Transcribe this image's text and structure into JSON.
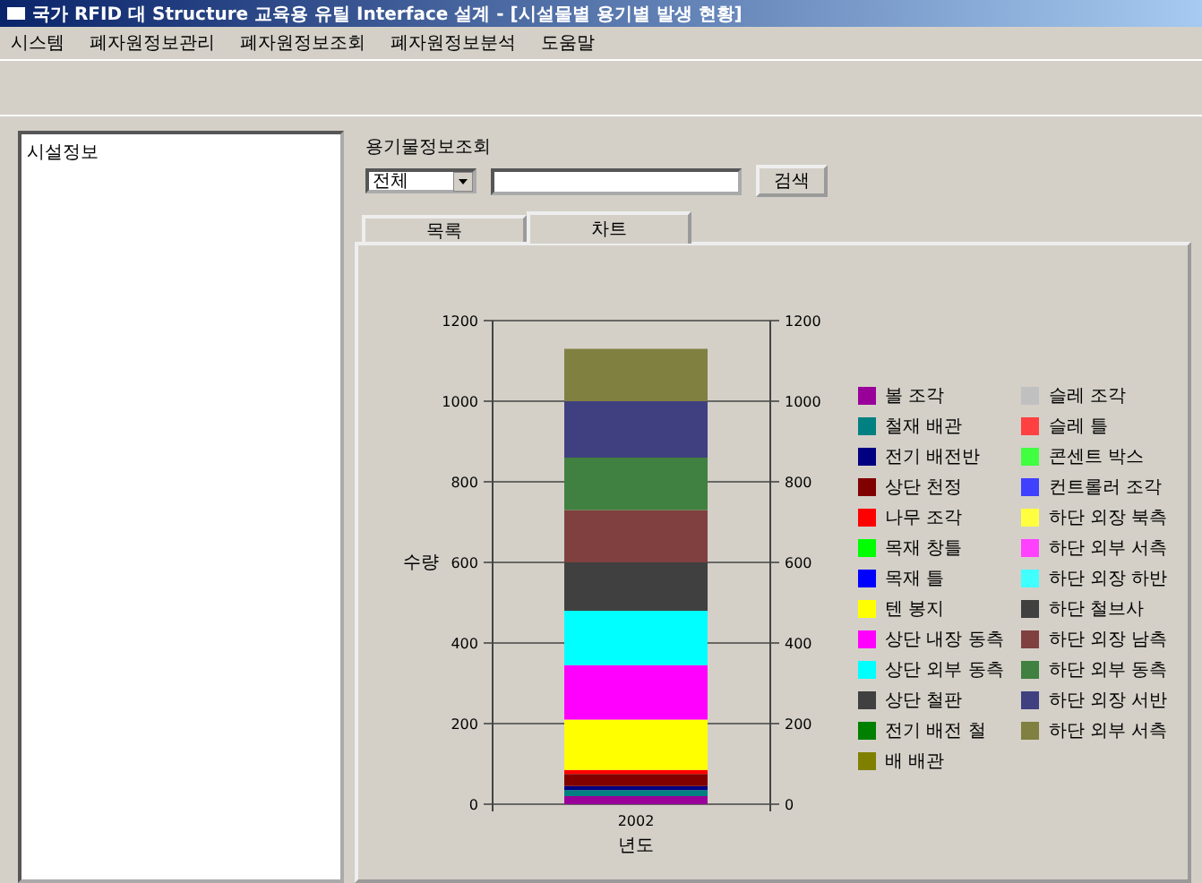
{
  "window": {
    "title": "국가 RFID 대 Structure 교육용 유틸 Interface 설계 - [시설물별 용기별 발생 현황]"
  },
  "menu": [
    "시스템",
    "폐자원정보관리",
    "폐자원정보조회",
    "폐자원정보분석",
    "도움말"
  ],
  "tree": {
    "items": [
      "시설정보"
    ]
  },
  "search": {
    "group_label": "용기물정보조회",
    "combo_value": "전체",
    "button": "검색"
  },
  "tabs": [
    {
      "label": "목록",
      "selected": false
    },
    {
      "label": "차트",
      "selected": true
    }
  ],
  "chart": {
    "left_axis_title": "수량",
    "left_axis_labels": [
      "1200",
      "1000",
      "800",
      "600",
      "400",
      "200",
      "0"
    ],
    "chart_data": {
      "type": "bar",
      "stacked": true,
      "grid": true,
      "xlabel": "년도",
      "categories": [
        "2002"
      ],
      "ylim": [
        0,
        1200
      ],
      "yticks": [
        0,
        200,
        400,
        600,
        800,
        1000,
        1200
      ],
      "series": [
        {
          "name": "볼 조각",
          "color": "#990099",
          "values": [
            20
          ]
        },
        {
          "name": "철재 배관",
          "color": "#008080",
          "values": [
            15
          ]
        },
        {
          "name": "전기 배전반",
          "color": "#000080",
          "values": [
            10
          ]
        },
        {
          "name": "상단 천정",
          "color": "#800000",
          "values": [
            30
          ]
        },
        {
          "name": "나무 조각",
          "color": "#ff0000",
          "values": [
            10
          ]
        },
        {
          "name": "목재 창틀",
          "color": "#00ff00",
          "values": [
            0
          ]
        },
        {
          "name": "목재 틀",
          "color": "#0000ff",
          "values": [
            0
          ]
        },
        {
          "name": "텐 봉지",
          "color": "#ffff00",
          "values": [
            125
          ]
        },
        {
          "name": "상단 내장 동측",
          "color": "#ff00ff",
          "values": [
            135
          ]
        },
        {
          "name": "상단 외부 동측",
          "color": "#00ffff",
          "values": [
            135
          ]
        },
        {
          "name": "상단 철판",
          "color": "#404040",
          "values": [
            0
          ]
        },
        {
          "name": "전기 배전 철",
          "color": "#008000",
          "values": [
            0
          ]
        },
        {
          "name": "배 배관",
          "color": "#808000",
          "values": [
            0
          ]
        },
        {
          "name": "슬레 조각",
          "color": "#c0c0c0",
          "values": [
            0
          ]
        },
        {
          "name": "슬레 틀",
          "color": "#ff4040",
          "values": [
            0
          ]
        },
        {
          "name": "콘센트 박스",
          "color": "#40ff40",
          "values": [
            0
          ]
        },
        {
          "name": "컨트롤러 조각",
          "color": "#4040ff",
          "values": [
            0
          ]
        },
        {
          "name": "하단 외장 북측",
          "color": "#ffff40",
          "values": [
            0
          ]
        },
        {
          "name": "하단 외부 서측",
          "color": "#ff40ff",
          "values": [
            0
          ]
        },
        {
          "name": "하단 외장 하반",
          "color": "#40ffff",
          "values": [
            0
          ]
        },
        {
          "name": "하단 철브사",
          "color": "#404040",
          "values": [
            120
          ]
        },
        {
          "name": "하단 외장 남측",
          "color": "#804040",
          "values": [
            130
          ]
        },
        {
          "name": "하단 외부 동측",
          "color": "#408040",
          "values": [
            130
          ]
        },
        {
          "name": "하단 외장 서반",
          "color": "#404080",
          "values": [
            140
          ]
        },
        {
          "name": "하단 외부 서측",
          "color": "#808040",
          "values": [
            130
          ]
        }
      ]
    }
  }
}
